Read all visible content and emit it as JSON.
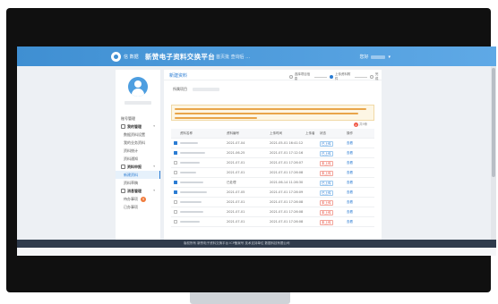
{
  "header": {
    "logo_text": "信 数据",
    "title": "新赞电子资料交换平台",
    "nav_links": "首页批  查询后 …",
    "user_prefix": "您好"
  },
  "sidebar": {
    "menu": [
      {
        "label": "账号管理",
        "type": "group-plain"
      },
      {
        "label": "我的管理",
        "type": "group",
        "icon": "folder-icon"
      },
      {
        "label": "数据资料设置",
        "type": "sub"
      },
      {
        "label": "我的业务资料",
        "type": "sub"
      },
      {
        "label": "资料统计",
        "type": "sub"
      },
      {
        "label": "资料通知",
        "type": "sub"
      },
      {
        "label": "资料申报",
        "type": "group",
        "icon": "doc-icon"
      },
      {
        "label": "新建资料",
        "type": "sub",
        "active": true
      },
      {
        "label": "资料草稿",
        "type": "sub"
      },
      {
        "label": "消息管理",
        "type": "group",
        "icon": "message-icon"
      },
      {
        "label": "待办事项",
        "type": "sub",
        "badge": "9"
      },
      {
        "label": "已办事项",
        "type": "sub"
      }
    ]
  },
  "main": {
    "breadcrumb": "新建资料",
    "steps": [
      {
        "label": "选择项目信息",
        "state": "done"
      },
      {
        "label": "上传资料附件",
        "state": "active"
      },
      {
        "label": "完成",
        "state": "todo"
      }
    ],
    "project_label": "所属项目",
    "notice_lines": 3,
    "table_total": "共9条",
    "table_badge": "2",
    "columns": [
      "资料名称",
      "资料编号",
      "上传时间",
      "上传者",
      "状态",
      "操作"
    ],
    "rows": [
      {
        "checked": true,
        "name_w": 20,
        "code": "2021-07-04",
        "time": "2021-05-01 16:41:12",
        "status": "已上传",
        "status_type": "ok",
        "op": "查看"
      },
      {
        "checked": true,
        "name_w": 28,
        "code": "2021-06-25",
        "time": "2021-07-01 17:12:16",
        "status": "已上传",
        "status_type": "ok",
        "op": "查看"
      },
      {
        "checked": false,
        "name_w": 22,
        "code": "2021-07-01",
        "time": "2021-07-01 17:26:07",
        "status": "未上传",
        "status_type": "warn",
        "op": "查看"
      },
      {
        "checked": false,
        "name_w": 18,
        "code": "2021-07-01",
        "time": "2021-07-01 17:26:08",
        "status": "未上传",
        "status_type": "warn",
        "op": "查看"
      },
      {
        "checked": true,
        "name_w": 26,
        "code": "已处理",
        "time": "2021-06-14 11:26:30",
        "status": "已上传",
        "status_type": "ok",
        "op": "查看"
      },
      {
        "checked": true,
        "name_w": 30,
        "code": "2021-07-05",
        "time": "2021-07-01 17:26:09",
        "status": "已上传",
        "status_type": "ok",
        "op": "查看"
      },
      {
        "checked": false,
        "name_w": 24,
        "code": "2021-07-01",
        "time": "2021-07-01 17:26:08",
        "status": "未上传",
        "status_type": "warn",
        "op": "查看"
      },
      {
        "checked": false,
        "name_w": 26,
        "code": "2021-07-01",
        "time": "2021-07-01 17:26:08",
        "status": "未上传",
        "status_type": "warn",
        "op": "查看"
      },
      {
        "checked": false,
        "name_w": 22,
        "code": "2021-07-01",
        "time": "2021-07-01 17:26:08",
        "status": "未上传",
        "status_type": "warn",
        "op": "查看"
      }
    ]
  },
  "footer": {
    "text": "版权所有 新赞电子资料交换平台   ICP备案号   技术支持单位 数据科技有限公司"
  },
  "colors": {
    "primary": "#2b7cd3",
    "header_start": "#3f8fd2",
    "header_end": "#5fa9e6",
    "warn": "#e8493a",
    "notice_bg": "#fdf6e4",
    "footer_bg": "#2f3b4c"
  }
}
